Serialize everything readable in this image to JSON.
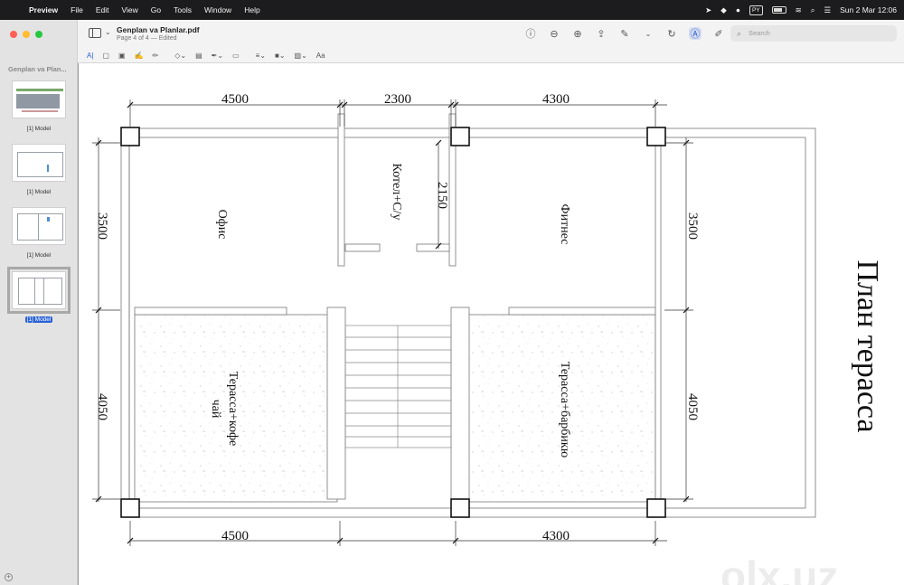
{
  "menubar": {
    "apple_icon": "apple-icon",
    "app_name": "Preview",
    "items": [
      "File",
      "Edit",
      "View",
      "Go",
      "Tools",
      "Window",
      "Help"
    ],
    "input_source": "PY",
    "datetime": "Sun 2 Mar  12:06"
  },
  "window": {
    "doc_title": "Genplan va Planlar.pdf",
    "doc_subtitle": "Page 4 of 4 — Edited",
    "search_placeholder": "Search"
  },
  "sidebar": {
    "title": "Genplan va Plan...",
    "pages": [
      {
        "label": "[1] Model",
        "selected": false
      },
      {
        "label": "[1] Model",
        "selected": false
      },
      {
        "label": "[1] Model",
        "selected": false
      },
      {
        "label": "[1] Model",
        "selected": true
      }
    ]
  },
  "markup_toolbar": {
    "text_tool": "A|",
    "font_tool": "Aa"
  },
  "drawing": {
    "title": "План терасса",
    "rooms": {
      "office": "Офис",
      "boiler": "Котел+С/у",
      "fitness": "Фитнес",
      "terrace_left": "Терасса+кофе",
      "terrace_left_2": "чай",
      "terrace_right": "Терасса+барбикю"
    },
    "dims": {
      "top_1": "4500",
      "top_2": "2300",
      "top_3": "4300",
      "bottom_1": "4500",
      "bottom_2": "4300",
      "left_1": "3500",
      "left_2": "4050",
      "right_1": "3500",
      "right_2": "4050",
      "inner": "2150"
    }
  },
  "watermark": "olx.uz",
  "colors": {
    "menubar_bg": "#1c1c1e",
    "accent": "#2a62d6"
  }
}
